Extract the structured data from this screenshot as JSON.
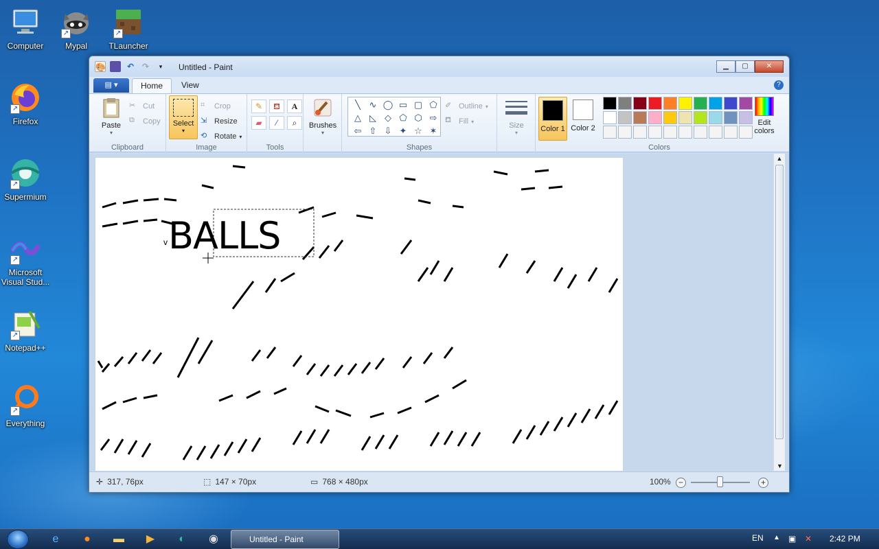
{
  "desktop": {
    "icons": [
      {
        "label": "Computer"
      },
      {
        "label": "Mypal"
      },
      {
        "label": "TLauncher"
      },
      {
        "label": "Firefox"
      },
      {
        "label": "Supermium"
      },
      {
        "label": "Microsoft Visual Stud..."
      },
      {
        "label": "Notepad++"
      },
      {
        "label": "Everything"
      }
    ]
  },
  "window": {
    "title": "Untitled - Paint",
    "tabs": {
      "file": "▤ ▾",
      "home": "Home",
      "view": "View"
    },
    "ribbon": {
      "clipboard": {
        "label": "Clipboard",
        "paste": "Paste",
        "cut": "Cut",
        "copy": "Copy"
      },
      "image": {
        "label": "Image",
        "select": "Select",
        "crop": "Crop",
        "resize": "Resize",
        "rotate": "Rotate"
      },
      "tools": {
        "label": "Tools"
      },
      "brushes": {
        "label": "Brushes"
      },
      "shapes": {
        "label": "Shapes",
        "outline": "Outline",
        "fill": "Fill",
        "glyphs": [
          "╲",
          "∿",
          "◯",
          "▭",
          "▢",
          "⬠",
          "△",
          "◺",
          "◇",
          "⬠",
          "⬡",
          "⇨",
          "⇦",
          "⇧",
          "⇩",
          "✦",
          "☆",
          "✶"
        ]
      },
      "size": {
        "label": "Size"
      },
      "colors": {
        "label": "Colors",
        "color1": "Color 1",
        "color2": "Color 2",
        "edit": "Edit colors",
        "color1_value": "#000000",
        "color2_value": "#ffffff",
        "palette": [
          "#000000",
          "#7f7f7f",
          "#880015",
          "#ed1c24",
          "#ff7f27",
          "#fff200",
          "#22b14c",
          "#00a2e8",
          "#3f48cc",
          "#a349a4",
          "#ffffff",
          "#c3c3c3",
          "#b97a57",
          "#ffaec9",
          "#ffc90e",
          "#efe4b0",
          "#b5e61d",
          "#99d9ea",
          "#7092be",
          "#c8bfe7",
          "#f4f4f4",
          "#f4f4f4",
          "#f4f4f4",
          "#f4f4f4",
          "#f4f4f4",
          "#f4f4f4",
          "#f4f4f4",
          "#f4f4f4",
          "#f4f4f4",
          "#f4f4f4"
        ]
      }
    },
    "canvas": {
      "text": "BALLS",
      "small_mark": "v"
    },
    "status": {
      "cursor": "317, 76px",
      "selection": "147 × 70px",
      "size": "768 × 480px",
      "zoom": "100%"
    }
  },
  "taskbar": {
    "task": "Untitled - Paint",
    "lang": "EN",
    "time": "2:42 PM"
  }
}
